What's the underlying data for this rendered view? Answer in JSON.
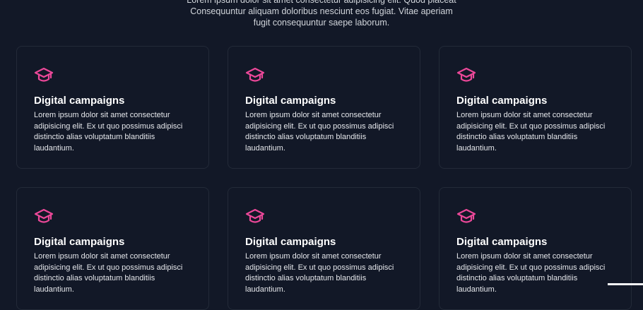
{
  "intro": {
    "line1": "Lorem ipsum dolor sit amet consectetur adipisicing elit. Quod placeat",
    "line2": "Consequuntur aliquam doloribus nesciunt eos fugiat. Vitae aperiam",
    "line3": "fugit consequuntur saepe laborum."
  },
  "colors": {
    "background": "#121827",
    "accent": "#ec4899",
    "card_border": "#232a38"
  },
  "cards": [
    {
      "icon": "graduation-cap-icon",
      "title": "Digital campaigns",
      "text": "Lorem ipsum dolor sit amet consectetur adipisicing elit. Ex ut quo possimus adipisci distinctio alias voluptatum blanditiis laudantium."
    },
    {
      "icon": "graduation-cap-icon",
      "title": "Digital campaigns",
      "text": "Lorem ipsum dolor sit amet consectetur adipisicing elit. Ex ut quo possimus adipisci distinctio alias voluptatum blanditiis laudantium."
    },
    {
      "icon": "graduation-cap-icon",
      "title": "Digital campaigns",
      "text": "Lorem ipsum dolor sit amet consectetur adipisicing elit. Ex ut quo possimus adipisci distinctio alias voluptatum blanditiis laudantium."
    },
    {
      "icon": "graduation-cap-icon",
      "title": "Digital campaigns",
      "text": "Lorem ipsum dolor sit amet consectetur adipisicing elit. Ex ut quo possimus adipisci distinctio alias voluptatum blanditiis laudantium."
    },
    {
      "icon": "graduation-cap-icon",
      "title": "Digital campaigns",
      "text": "Lorem ipsum dolor sit amet consectetur adipisicing elit. Ex ut quo possimus adipisci distinctio alias voluptatum blanditiis laudantium."
    },
    {
      "icon": "graduation-cap-icon",
      "title": "Digital campaigns",
      "text": "Lorem ipsum dolor sit amet consectetur adipisicing elit. Ex ut quo possimus adipisci distinctio alias voluptatum blanditiis laudantium."
    }
  ]
}
